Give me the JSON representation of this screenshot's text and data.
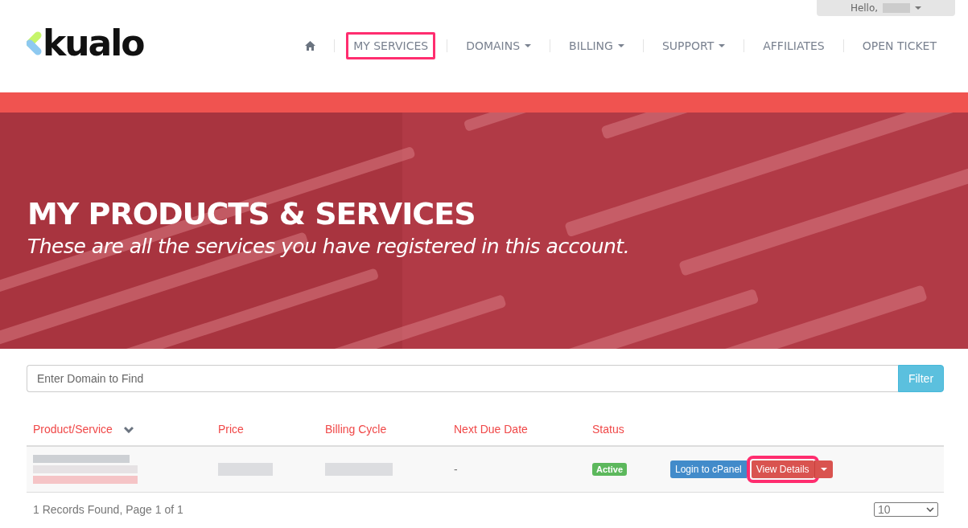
{
  "header": {
    "logo": "kualo",
    "user_menu": {
      "greeting": "Hello,"
    },
    "nav": [
      {
        "kind": "icon",
        "highlighted": false
      },
      {
        "kind": "link",
        "label": "MY SERVICES",
        "dropdown": false,
        "highlighted": true
      },
      {
        "kind": "link",
        "label": "DOMAINS",
        "dropdown": true,
        "highlighted": false
      },
      {
        "kind": "link",
        "label": "BILLING",
        "dropdown": true,
        "highlighted": false
      },
      {
        "kind": "link",
        "label": "SUPPORT",
        "dropdown": true,
        "highlighted": false
      },
      {
        "kind": "link",
        "label": "AFFILIATES",
        "dropdown": false,
        "highlighted": false
      },
      {
        "kind": "link",
        "label": "OPEN TICKET",
        "dropdown": false,
        "highlighted": false
      }
    ]
  },
  "hero": {
    "title": "MY PRODUCTS & SERVICES",
    "subtitle": "These are all the services you have registered in this account."
  },
  "filter": {
    "placeholder": "Enter Domain to Find",
    "button": "Filter"
  },
  "table": {
    "columns": [
      {
        "label": "Product/Service",
        "sorted": true
      },
      {
        "label": "Price",
        "sorted": false
      },
      {
        "label": "Billing Cycle",
        "sorted": false
      },
      {
        "label": "Next Due Date",
        "sorted": false
      },
      {
        "label": "Status",
        "sorted": false
      }
    ],
    "rows": [
      {
        "next_due_date": "-",
        "status": "Active",
        "login_button": "Login to cPanel",
        "details_button": "View Details",
        "details_highlighted": true
      }
    ]
  },
  "footer": {
    "records": "1 Records Found, Page 1 of 1",
    "page_size": "10"
  }
}
